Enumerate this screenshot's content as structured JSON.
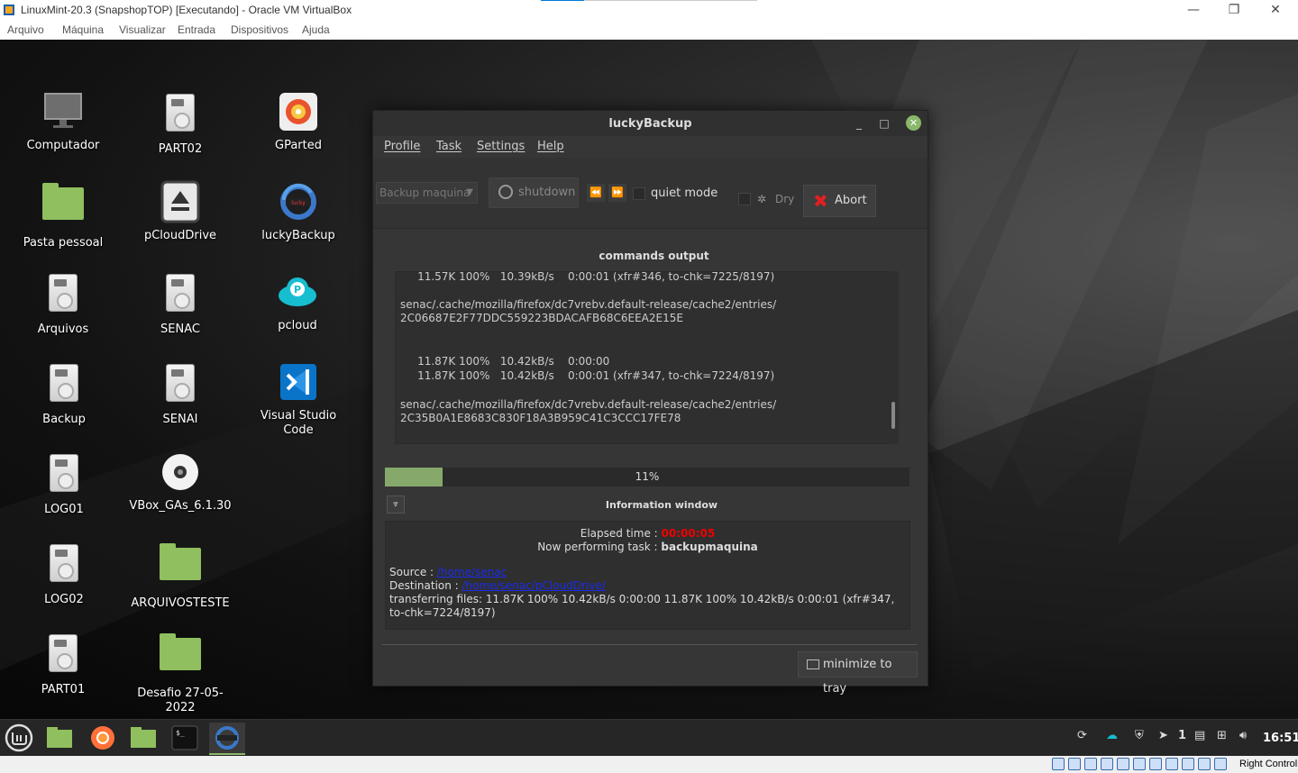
{
  "host": {
    "title": "LinuxMint-20.3 (SnapshopTOP) [Executando] - Oracle VM VirtualBox",
    "menu": [
      "Arquivo",
      "Máquina",
      "Visualizar",
      "Entrada",
      "Dispositivos",
      "Ajuda"
    ],
    "controls": {
      "minimize": "—",
      "restore": "❐",
      "close": "✕"
    },
    "host_key": "Right Control"
  },
  "desktop": {
    "icons": [
      {
        "label": "Computador",
        "icon": "monitor-icon"
      },
      {
        "label": "PART02",
        "icon": "drive-icon"
      },
      {
        "label": "GParted",
        "icon": "gparted-icon"
      },
      {
        "label": "Pasta pessoal",
        "icon": "home-folder-icon"
      },
      {
        "label": "pCloudDrive",
        "icon": "eject-drive-icon"
      },
      {
        "label": "luckyBackup",
        "icon": "luckybackup-icon"
      },
      {
        "label": "Arquivos",
        "icon": "drive-icon"
      },
      {
        "label": "SENAC",
        "icon": "drive-icon"
      },
      {
        "label": "pcloud",
        "icon": "pcloud-icon"
      },
      {
        "label": "Backup",
        "icon": "drive-icon"
      },
      {
        "label": "SENAI",
        "icon": "drive-icon"
      },
      {
        "label": "Visual Studio Code",
        "icon": "vscode-icon"
      },
      {
        "label": "LOG01",
        "icon": "drive-icon"
      },
      {
        "label": "VBox_GAs_6.1.30",
        "icon": "disc-icon"
      },
      {
        "label": "LOG02",
        "icon": "drive-icon"
      },
      {
        "label": "ARQUIVOSTESTE",
        "icon": "folder-icon"
      },
      {
        "label": "PART01",
        "icon": "drive-icon"
      },
      {
        "label": "Desafio 27-05-2022",
        "icon": "folder-icon"
      }
    ]
  },
  "lb": {
    "title": "luckyBackup",
    "menu": [
      "Profile",
      "Task",
      "Settings",
      "Help"
    ],
    "profile_value": "Backup maquina",
    "shutdown_label": "shutdown",
    "quiet_label": "quiet mode",
    "dry_label": "Dry",
    "abort_label": "Abort",
    "commands_title": "commands output",
    "output_lines": [
      "     11.57K 100%   10.39kB/s    0:00:01 (xfr#346, to-chk=7225/8197)",
      "",
      "senac/.cache/mozilla/firefox/dc7vrebv.default-release/cache2/entries/",
      "2C06687E2F77DDC559223BDACAFB68C6EEA2E15E",
      "",
      "",
      "     11.87K 100%   10.42kB/s    0:00:00",
      "     11.87K 100%   10.42kB/s    0:00:01 (xfr#347, to-chk=7224/8197)",
      "",
      "senac/.cache/mozilla/firefox/dc7vrebv.default-release/cache2/entries/",
      "2C35B0A1E8683C830F18A3B959C41C3CCC17FE78"
    ],
    "progress_percent": 11,
    "progress_label": "11%",
    "info_title": "Information window",
    "elapsed_label": "Elapsed time : ",
    "elapsed_value": "00:00:05",
    "task_label": "Now performing task : ",
    "task_value": "backupmaquina",
    "source_label": "Source : ",
    "source_value": "/home/senac",
    "dest_label": "Destination : ",
    "dest_value": "/home/senac/pCloudDrive/",
    "transfer_text": "transferring files: 11.87K 100% 10.42kB/s 0:00:00 11.87K 100% 10.42kB/s 0:00:01 (xfr#347, to-chk=7224/8197)",
    "minimize_label": "minimize to tray"
  },
  "taskbar": {
    "workspace": "1",
    "clock": "16:51"
  },
  "colors": {
    "accent_green": "#8ab86a",
    "progress_fill": "#86a86a",
    "elapsed_red": "#e00000",
    "path_blue": "#1a2be8"
  }
}
